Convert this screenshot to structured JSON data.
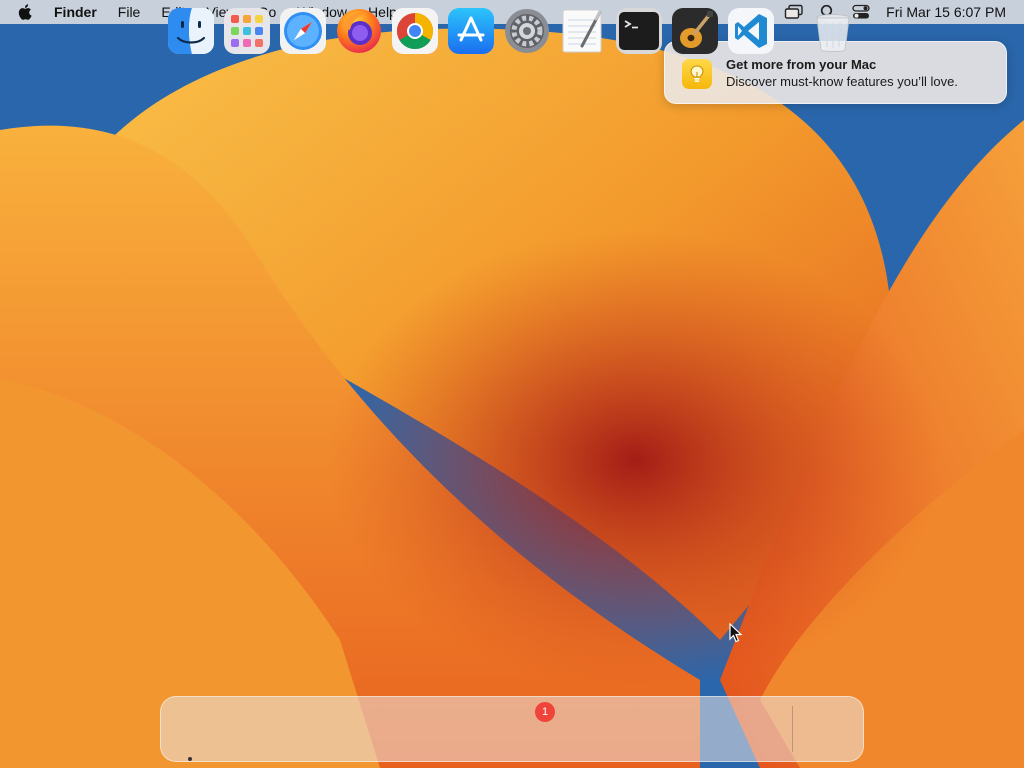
{
  "menubar": {
    "apple_icon": "apple-logo-icon",
    "app_name": "Finder",
    "menus": [
      "File",
      "Edit",
      "View",
      "Go",
      "Window",
      "Help"
    ],
    "status_icons": [
      "screen-mirroring-icon",
      "spotlight-search-icon",
      "control-center-icon"
    ],
    "clock": "Fri Mar 15  6:07 PM"
  },
  "notification": {
    "icon": "lightbulb-icon",
    "title": "Get more from your Mac",
    "body": "Discover must-know features you’ll love."
  },
  "dock": {
    "apps": [
      {
        "name": "Finder",
        "icon": "finder-icon",
        "running": true
      },
      {
        "name": "Launchpad",
        "icon": "launchpad-icon"
      },
      {
        "name": "Safari",
        "icon": "safari-icon"
      },
      {
        "name": "Firefox",
        "icon": "firefox-icon"
      },
      {
        "name": "Google Chrome",
        "icon": "chrome-icon"
      },
      {
        "name": "App Store",
        "icon": "app-store-icon"
      },
      {
        "name": "System Settings",
        "icon": "system-settings-icon",
        "badge": "1"
      },
      {
        "name": "TextEdit",
        "icon": "textedit-icon"
      },
      {
        "name": "Terminal",
        "icon": "terminal-icon"
      },
      {
        "name": "GarageBand",
        "icon": "garageband-icon"
      },
      {
        "name": "Visual Studio Code",
        "icon": "vscode-icon"
      },
      {
        "name": "Trash",
        "icon": "trash-icon"
      }
    ]
  },
  "colors": {
    "badge": "#f0433a",
    "wallpaper_orange": "#ef7a22",
    "wallpaper_blue": "#1e5aa0"
  }
}
